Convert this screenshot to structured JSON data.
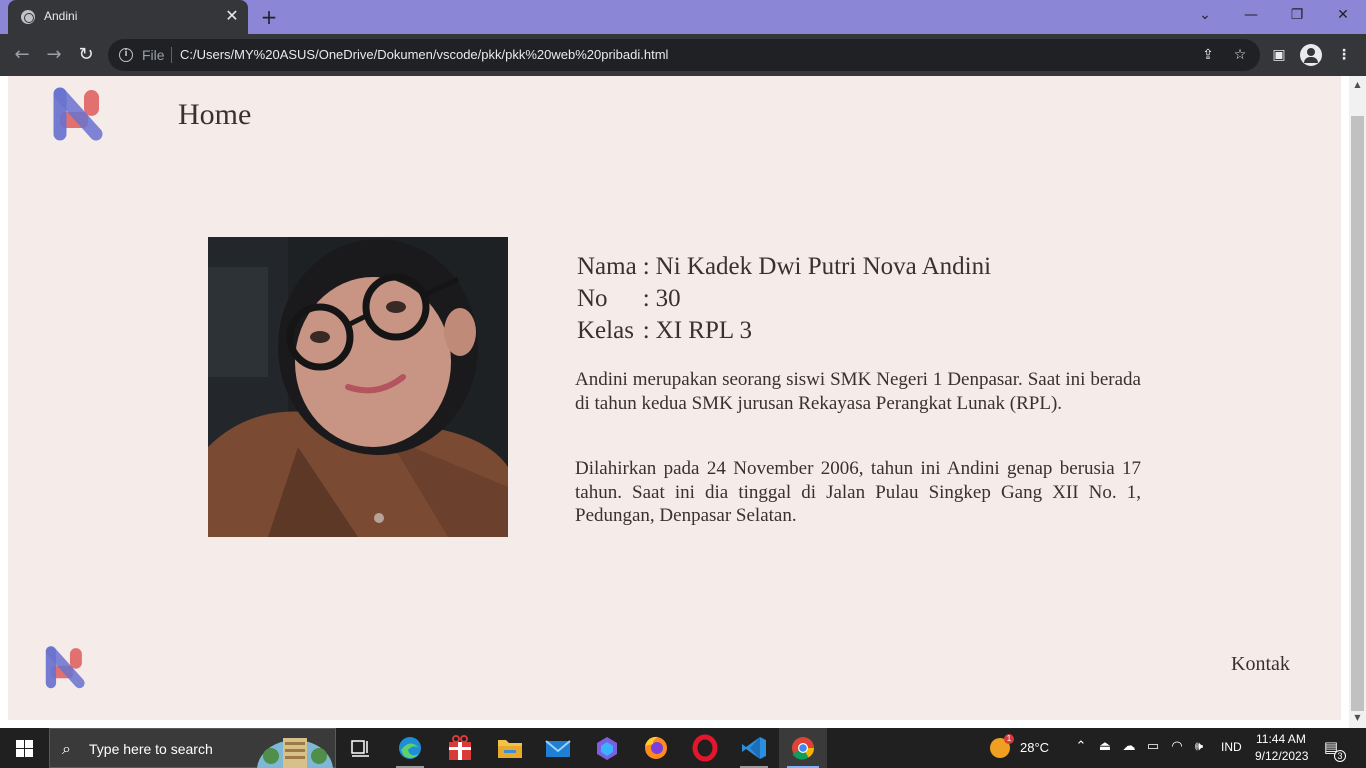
{
  "browser": {
    "tab_title": "Andini",
    "tab_close": "✕",
    "new_tab": "+",
    "file_label": "File",
    "url": "C:/Users/MY%20ASUS/OneDrive/Dokumen/vscode/pkk/pkk%20web%20pribadi.html",
    "icons": [
      "globe-icon",
      "back-icon",
      "forward-icon",
      "reload-icon",
      "info-icon",
      "share-icon",
      "star-icon",
      "side-panel-icon",
      "profile-icon",
      "menu-icon"
    ]
  },
  "page": {
    "colors": {
      "background": "#f5ecea",
      "text": "#3a302d",
      "logo_blue": "#6a73cf",
      "logo_red": "#e2706e"
    },
    "nav": {
      "home": "Home"
    },
    "profile": {
      "rows": [
        {
          "label": "Nama",
          "sep": ":",
          "value": "Ni Kadek Dwi Putri Nova Andini"
        },
        {
          "label": "No",
          "sep": ":",
          "value": "30"
        },
        {
          "label": "Kelas",
          "sep": ":",
          "value": "XI RPL 3"
        }
      ]
    },
    "bio": [
      "Andini merupakan seorang siswi SMK Negeri 1 Denpasar. Saat ini berada di tahun kedua SMK jurusan Rekayasa Perangkat Lunak (RPL).",
      "Dilahirkan pada 24 November 2006, tahun ini Andini genap berusia 17 tahun. Saat ini dia tinggal di Jalan Pulau Singkep Gang XII No. 1, Pedungan, Denpasar Selatan."
    ],
    "footer": {
      "kontak": "Kontak"
    }
  },
  "taskbar": {
    "search_placeholder": "Type here to search",
    "apps": [
      "task-view",
      "edge",
      "gift-app",
      "file-explorer",
      "mail",
      "copilot",
      "firefox",
      "opera",
      "vscode",
      "chrome"
    ],
    "weather": {
      "temp": "28°C",
      "badge": "1"
    },
    "language": "IND",
    "time": "11:44 AM",
    "date": "9/12/2023",
    "notifications": "3"
  }
}
